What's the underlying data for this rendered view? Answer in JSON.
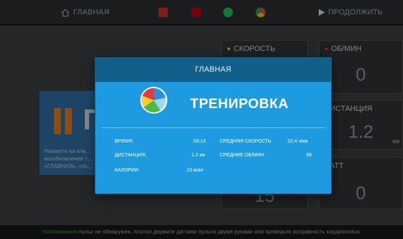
{
  "topbar": {
    "home_label": "ГЛАВНАЯ",
    "continue_label": "ПРОДОЛЖИТЬ",
    "apps": [
      {
        "name": "youtube",
        "color": "#c4302b"
      },
      {
        "name": "netflix",
        "color": "#b1060f"
      },
      {
        "name": "spotify",
        "color": "#1db954"
      },
      {
        "name": "chrome",
        "color": "#f2b40d"
      }
    ]
  },
  "left_panel": {
    "pause_text": "П",
    "hint": "Нажмите на кла… возобновления т… «ГЛАВНАЯ», что…"
  },
  "metrics": {
    "speed": {
      "label": "СКОРОСТЬ",
      "dot_color": "#d9b92a"
    },
    "rpm": {
      "label": "ОБ/МИН",
      "value": "0",
      "dot_color": "#d9352a"
    },
    "distance": {
      "label": "ДИСТАНЦИЯ",
      "value": "1.2",
      "unit": "км"
    },
    "watt": {
      "label": "ВАТТ",
      "value": "0"
    },
    "partial_value": "15"
  },
  "dialog": {
    "header": "ГЛАВНАЯ",
    "title": "ТРЕНИРОВКА",
    "pie_colors": [
      "#e23b3b",
      "#f7d02c",
      "#4fb84a",
      "#2a8fd6",
      "#a0d8f0"
    ],
    "stats": {
      "time_label": "ВРЕМЯ:",
      "time_value": "03:13",
      "avg_speed_label": "СРЕДНЯЯ СКОРОСТЬ",
      "avg_speed_value": "22,4 ч/км",
      "distance_label": "ДИСТАНЦИЯ:",
      "distance_value": "1.2 км",
      "avg_rpm_label": "СРЕДНИЕ ОБ/МИН",
      "avg_rpm_value": "59",
      "calories_label": "КАЛОРИИ:",
      "calories_value": "13 ккал"
    }
  },
  "footer": {
    "highlight": "Напоминание:",
    "text": "пульс не обнаружен, плотно держите датчики пульса двумя руками или проверьте исправность кардиопояса."
  }
}
